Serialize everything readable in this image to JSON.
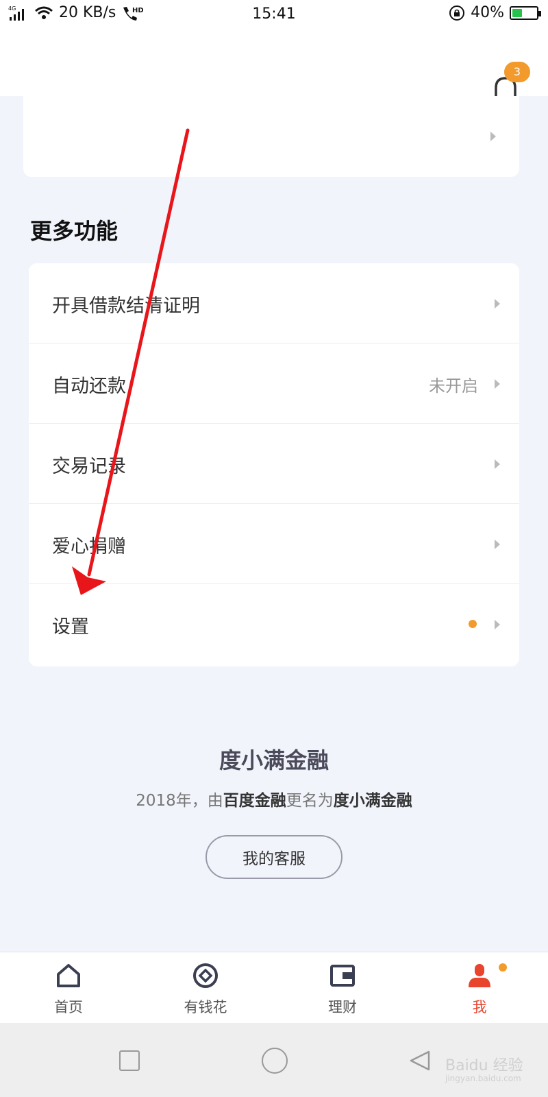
{
  "status_bar": {
    "network": "4G",
    "speed": "20 KB/s",
    "hd": "HD",
    "time": "15:41",
    "battery": "40%",
    "battery_level": 0.4
  },
  "header": {
    "notification_count": "3"
  },
  "section": {
    "title": "更多功能"
  },
  "menu": [
    {
      "label": "开具借款结清证明",
      "value": ""
    },
    {
      "label": "自动还款",
      "value": "未开启"
    },
    {
      "label": "交易记录",
      "value": ""
    },
    {
      "label": "爱心捐赠",
      "value": ""
    },
    {
      "label": "设置",
      "value": ""
    }
  ],
  "brand": {
    "title": "度小满金融",
    "sub_prefix": "2018年，由",
    "sub_old": "百度金融",
    "sub_mid": "更名为",
    "sub_new": "度小满金融"
  },
  "service_button": "我的客服",
  "tabs": [
    {
      "label": "首页",
      "icon": "home-icon"
    },
    {
      "label": "有钱花",
      "icon": "coin-icon"
    },
    {
      "label": "理财",
      "icon": "wallet-icon"
    },
    {
      "label": "我",
      "icon": "user-icon"
    }
  ],
  "watermark": {
    "text": "Baidu 经验",
    "sub": "jingyan.baidu.com"
  },
  "colors": {
    "accent": "#f29b2c",
    "active_tab": "#e8442e",
    "arrow": "#e8161b"
  }
}
